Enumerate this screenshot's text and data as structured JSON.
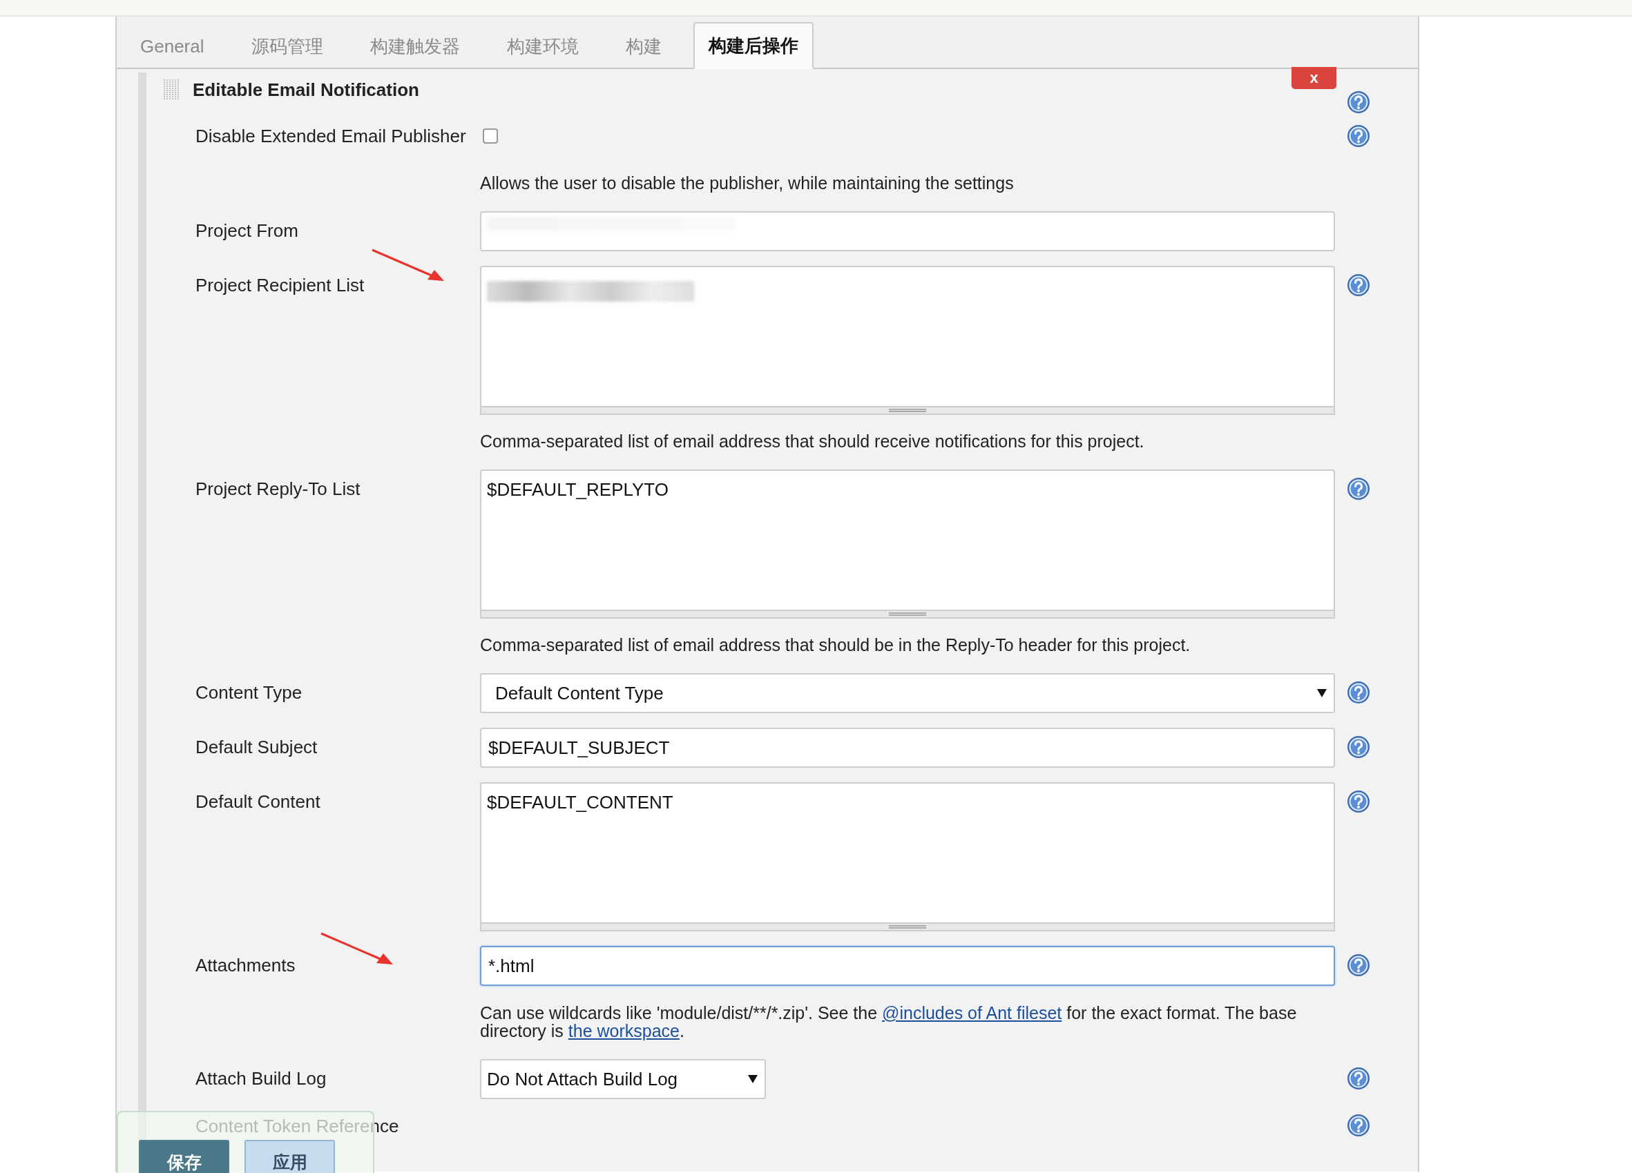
{
  "tabs": [
    {
      "label": "General",
      "selected": false
    },
    {
      "label": "源码管理",
      "selected": false
    },
    {
      "label": "构建触发器",
      "selected": false
    },
    {
      "label": "构建环境",
      "selected": false
    },
    {
      "label": "构建",
      "selected": false
    },
    {
      "label": "构建后操作",
      "selected": true
    }
  ],
  "section": {
    "title": "Editable Email Notification",
    "delete_label": "x",
    "help_icon": true
  },
  "fields": [
    {
      "kind": "checkbox",
      "label": "Disable Extended Email Publisher",
      "checked": false,
      "help_icon": true,
      "help": [
        {
          "text": "Allows the user to disable the publisher, while maintaining the settings"
        }
      ]
    },
    {
      "kind": "redacted-text",
      "label": "Project From",
      "help_icon": false
    },
    {
      "kind": "redacted-textarea",
      "label": "Project Recipient List",
      "annotated": true,
      "help_icon": true,
      "help": [
        {
          "text": "Comma-separated list of email address that should receive notifications for this project."
        }
      ]
    },
    {
      "kind": "textarea",
      "label": "Project Reply-To List",
      "value": "$DEFAULT_REPLYTO",
      "help_icon": true,
      "help": [
        {
          "text": "Comma-separated list of email address that should be in the Reply-To header for this project."
        }
      ]
    },
    {
      "kind": "select",
      "label": "Content Type",
      "value": "Default Content Type",
      "help_icon": true
    },
    {
      "kind": "text",
      "label": "Default Subject",
      "value": "$DEFAULT_SUBJECT",
      "help_icon": true
    },
    {
      "kind": "textarea",
      "label": "Default Content",
      "value": "$DEFAULT_CONTENT",
      "help_icon": true
    },
    {
      "kind": "text",
      "label": "Attachments",
      "value": "*.html",
      "focused": true,
      "annotated": true,
      "help_icon": true,
      "help": [
        {
          "text": "Can use wildcards like 'module/dist/**/*.zip'. See the "
        },
        {
          "text": "@includes of Ant fileset",
          "link": true
        },
        {
          "text": " for the exact format. The base directory is "
        },
        {
          "text": "the workspace",
          "link": true
        },
        {
          "text": "."
        }
      ]
    },
    {
      "kind": "small-select",
      "label": "Attach Build Log",
      "value": "Do Not Attach Build Log",
      "help_icon": true
    },
    {
      "kind": "label",
      "label": "Content Token Reference",
      "help_icon": true
    }
  ],
  "footer_buttons": [
    {
      "label": "保存",
      "kind": "primary"
    },
    {
      "label": "应用",
      "kind": "secondary"
    }
  ]
}
